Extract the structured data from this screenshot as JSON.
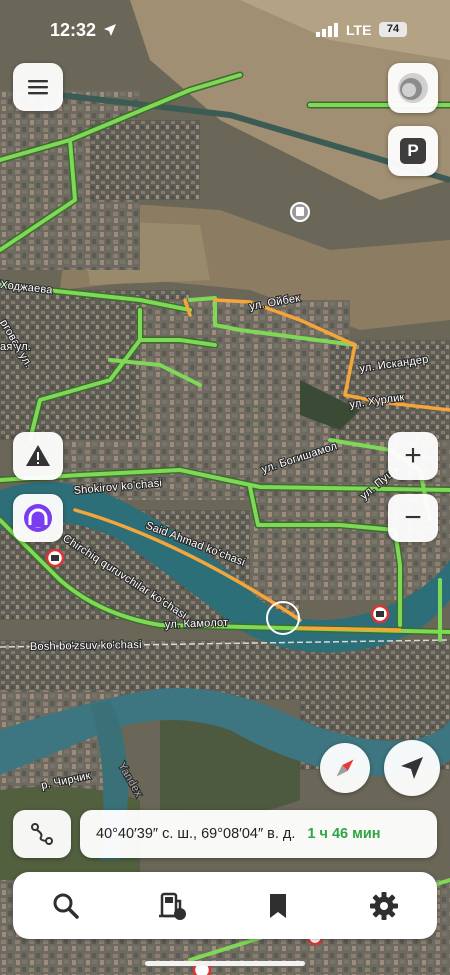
{
  "status_bar": {
    "time": "12:32",
    "network": "LTE",
    "battery": "74"
  },
  "streets": {
    "khodzhaeva": "Ходжаева",
    "oybek": "ул. Ойбек",
    "iskander": "ул. Искандер",
    "hurlik": "ул. Хурлик",
    "bogishamol": "ул. Богишамол",
    "pushk": "ул. Пушк",
    "shokirov": "Shokirov ko'chasi",
    "said_ahmad": "Said Ahmad ko'chasi",
    "chirchiq": "Chirchiq quruvchilar ko'chasi",
    "kamolot": "ул. Камолот",
    "bosh_bozsuv": "Bosh bo'zsuv ko'chasi",
    "chirchik_river": "р. Чирчик",
    "yandex_watermark": "Yandex",
    "left_edge_1": "рговая ул.",
    "left_edge_2": "ая ул."
  },
  "controls": {
    "menu_icon": "hamburger-menu-icon",
    "parking_label": "P",
    "zoom_in": "+",
    "zoom_out": "−"
  },
  "coordinates_bar": {
    "coordinates": "40°40′39″ с. ш., 69°08′04″ в. д.",
    "eta": "1 ч 46 мин"
  },
  "tabbar": {
    "items": [
      {
        "name": "search",
        "icon": "search-icon"
      },
      {
        "name": "gas-station",
        "icon": "fuel-pump-icon"
      },
      {
        "name": "bookmarks",
        "icon": "bookmark-icon"
      },
      {
        "name": "settings",
        "icon": "gear-icon"
      }
    ]
  },
  "colors": {
    "traffic_free": "#7ed957",
    "traffic_slow": "#f5a53a",
    "river": "#2d6f78",
    "eta_green": "#2fa543",
    "alice_purple": "#7a3cf0"
  }
}
